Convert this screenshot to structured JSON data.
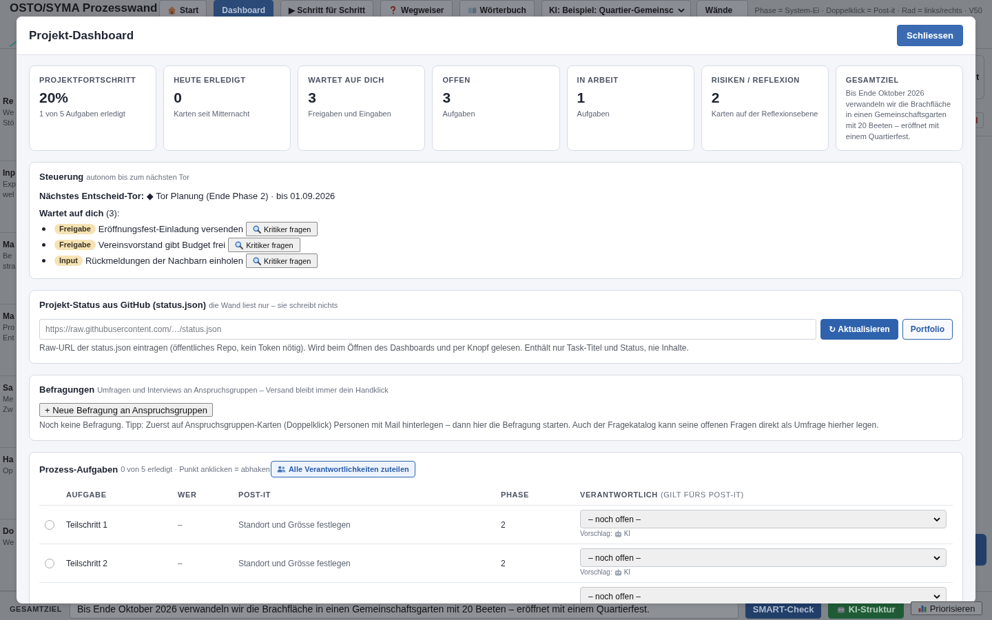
{
  "background": {
    "app_title": "OSTO/SYMA Prozesswand",
    "nav": [
      {
        "label": "Start",
        "kind": "home",
        "selected": false
      },
      {
        "label": "Dashboard",
        "kind": "plain",
        "selected": true
      },
      {
        "label": "▶ Schritt für Schritt",
        "kind": "plain",
        "selected": false
      },
      {
        "label": "Wegweiser",
        "kind": "help",
        "selected": false
      },
      {
        "label": "Wörterbuch",
        "kind": "glossary",
        "selected": false
      }
    ],
    "example_select": {
      "value": "KI: Beispiel: Quartier-Gemeinsc"
    },
    "walls_button": "Wände",
    "hint": "Phase = System-Ei · Doppelklick = Post-it · Rad = links/rechts · V50",
    "side_cards": [
      {
        "title": "Re",
        "lines": [
          "We",
          "Stö"
        ]
      },
      {
        "title": "Inp",
        "lines": [
          "Exp",
          "wel"
        ]
      },
      {
        "title": "Ma",
        "lines": [
          "Be",
          "stra"
        ]
      },
      {
        "title": "Ma",
        "lines": [
          "Pro",
          "Ent"
        ]
      },
      {
        "title": "Sa",
        "lines": [
          "Me",
          "Zw"
        ]
      },
      {
        "title": "Ha",
        "lines": [
          "Op"
        ]
      },
      {
        "title": "Do",
        "lines": [
          "We"
        ]
      }
    ],
    "right_panel": {
      "card_fragment": "t"
    },
    "goal_bar": {
      "label": "GESAMTZIEL",
      "value": "Bis Ende Oktober 2026 verwandeln wir die Brachfläche in einen Gemeinschaftsgarten mit 20 Beeten – eröffnet mit einem Quartierfest.",
      "buttons": [
        {
          "kind": "primary",
          "label": "SMART-Check"
        },
        {
          "kind": "accent",
          "label": "KI-Struktur"
        },
        {
          "kind": "chart",
          "label": "Priorisieren"
        }
      ]
    }
  },
  "dialog": {
    "title": "Projekt-Dashboard",
    "close_button": "Schliessen",
    "stats": [
      {
        "label": "PROJEKTFORTSCHRITT",
        "value": "20%",
        "note": "1 von 5 Aufgaben erledigt"
      },
      {
        "label": "HEUTE ERLEDIGT",
        "value": "0",
        "note": "Karten seit Mitternacht"
      },
      {
        "label": "WARTET AUF DICH",
        "value": "3",
        "note": "Freigaben und Eingaben"
      },
      {
        "label": "OFFEN",
        "value": "3",
        "note": "Aufgaben"
      },
      {
        "label": "IN ARBEIT",
        "value": "1",
        "note": "Aufgaben"
      },
      {
        "label": "RISIKEN / REFLEXION",
        "value": "2",
        "note": "Karten auf der Reflexionsebene"
      },
      {
        "label": "GESAMTZIEL",
        "text": "Bis Ende Oktober 2026 verwandeln wir die Brachfläche in einen Gemeinschaftsgarten mit 20 Beeten – eröffnet mit einem Quartierfest."
      }
    ],
    "steering": {
      "title": "Steuerung",
      "subtitle": "autonom bis zum nächsten Tor",
      "next_gate": "**Nächstes Entscheid-Tor:** ◆ Tor Planung (Ende Phase 2) · bis 01.09.2026",
      "waiting_heading": "**Wartet auf dich** (3):",
      "waiting": [
        {
          "tag": "Freigabe",
          "text": "Eröffnungsfest-Einladung versenden",
          "action": "Kritiker fragen"
        },
        {
          "tag": "Freigabe",
          "text": "Vereinsvorstand gibt Budget frei",
          "action": "Kritiker fragen"
        },
        {
          "tag": "Input",
          "text": "Rückmeldungen der Nachbarn einholen",
          "action": "Kritiker fragen"
        }
      ]
    },
    "github": {
      "title": "Projekt-Status aus GitHub (status.json)",
      "subtitle": "die Wand liest nur – sie schreibt nichts",
      "url_field": {
        "placeholder": "https://raw.githubusercontent.com/…/status.json"
      },
      "buttons": [
        {
          "label": "↻ Aktualisieren",
          "kind": "primary"
        },
        {
          "label": "Portfolio",
          "kind": "outline"
        }
      ],
      "help": "Raw-URL der status.json eintragen (öffentliches Repo, kein Token nötig). Wird beim Öffnen des Dashboards und per Knopf gelesen. Enthält nur Task-Titel und Status, nie Inhalte."
    },
    "surveys": {
      "title": "Befragungen",
      "subtitle": "Umfragen und Interviews an Anspruchsgruppen – Versand bleibt immer dein Handklick",
      "new_button": "+ Neue Befragung an Anspruchsgruppen",
      "empty_text": "Noch keine Befragung. Tipp: Zuerst auf Anspruchsgruppen-Karten (Doppelklick) Personen mit Mail hinterlegen – dann hier die Befragung starten. Auch der Fragekatalog kann seine offenen Fragen direkt als Umfrage hierher legen."
    },
    "tasks": {
      "title": "Prozess-Aufgaben",
      "subtitle": "0 von 5 erledigt · Punkt anklicken = abhaken",
      "assign_button": "Alle Verantwortlichkeiten zuteilen",
      "columns": [
        {
          "label": "AUFGABE"
        },
        {
          "label": "WER"
        },
        {
          "label": "POST-IT"
        },
        {
          "label": "PHASE"
        },
        {
          "label": "VERANTWORTLICH",
          "note": "(GILT FÜRS POST-IT)"
        }
      ],
      "rows": [
        {
          "done": false,
          "task": "Teilschritt 1",
          "who": "–",
          "postit": "Standort und Grösse festlegen",
          "phase": "2",
          "assignee": "– noch offen –",
          "suggestion_label": "Vorschlag:",
          "suggestion": "KI"
        },
        {
          "done": false,
          "task": "Teilschritt 2",
          "who": "–",
          "postit": "Standort und Grösse festlegen",
          "phase": "2",
          "assignee": "– noch offen –",
          "suggestion_label": "Vorschlag:",
          "suggestion": "KI"
        },
        {
          "assignee": "– noch offen –"
        }
      ]
    }
  }
}
